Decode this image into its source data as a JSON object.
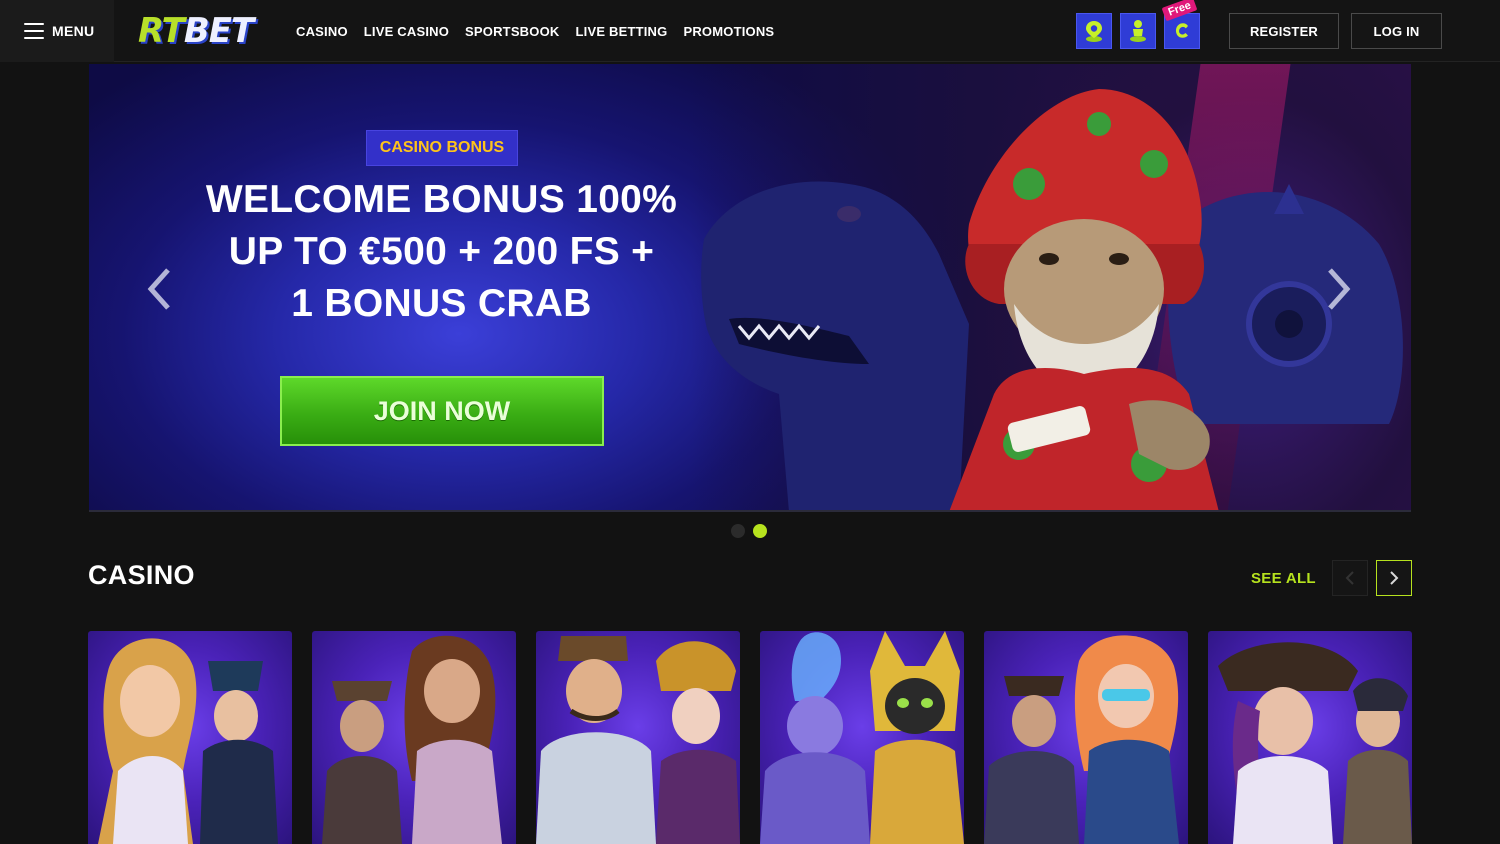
{
  "header": {
    "menu_label": "MENU",
    "logo_rt": "RT",
    "logo_bet": "BET",
    "nav": [
      "CASINO",
      "LIVE CASINO",
      "SPORTSBOOK",
      "LIVE BETTING",
      "PROMOTIONS"
    ],
    "free_badge": "Free",
    "register_label": "REGISTER",
    "login_label": "LOG IN",
    "icons": [
      "map-pin-icon",
      "person-icon",
      "c-coin-icon"
    ]
  },
  "hero": {
    "badge": "CASINO BONUS",
    "title_lines": [
      "WELCOME BONUS 100%",
      "UP TO €500 + 200 FS +",
      "1 BONUS CRAB"
    ],
    "cta": "JOIN NOW",
    "slides_total": 2,
    "active_slide": 2
  },
  "casino": {
    "title": "CASINO",
    "see_all": "SEE ALL",
    "cards": [
      "game-1",
      "game-2",
      "game-3",
      "game-4",
      "game-5",
      "game-6"
    ]
  },
  "colors": {
    "accent": "#b6e21e",
    "badge_text": "#ffc41a",
    "cta_green": "#3aad14",
    "icon_blue": "#2f3cd6"
  }
}
